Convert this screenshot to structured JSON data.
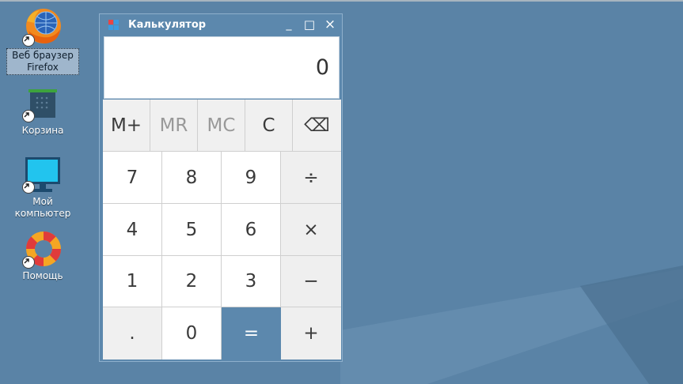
{
  "desktop": {
    "icons": [
      {
        "label_line1": "Веб браузер",
        "label_line2": "Firefox",
        "icon": "firefox-icon"
      },
      {
        "label_line1": "Корзина",
        "label_line2": "",
        "icon": "trash-icon"
      },
      {
        "label_line1": "Мой",
        "label_line2": "компьютер",
        "icon": "computer-icon"
      },
      {
        "label_line1": "Помощь",
        "label_line2": "",
        "icon": "lifebuoy-icon"
      }
    ]
  },
  "window": {
    "title": "Калькулятор",
    "minimize": "_",
    "maximize": "□",
    "close": "×"
  },
  "calculator": {
    "display": "0",
    "memory_keys": [
      "M+",
      "MR",
      "MC",
      "C",
      "⌫"
    ],
    "rows": [
      [
        "7",
        "8",
        "9",
        "÷"
      ],
      [
        "4",
        "5",
        "6",
        "×"
      ],
      [
        "1",
        "2",
        "3",
        "−"
      ],
      [
        ".",
        "0",
        "=",
        "+"
      ]
    ]
  },
  "colors": {
    "desktop": "#5a83a6",
    "window": "#5c88ad",
    "equals_key": "#5c88ad"
  }
}
